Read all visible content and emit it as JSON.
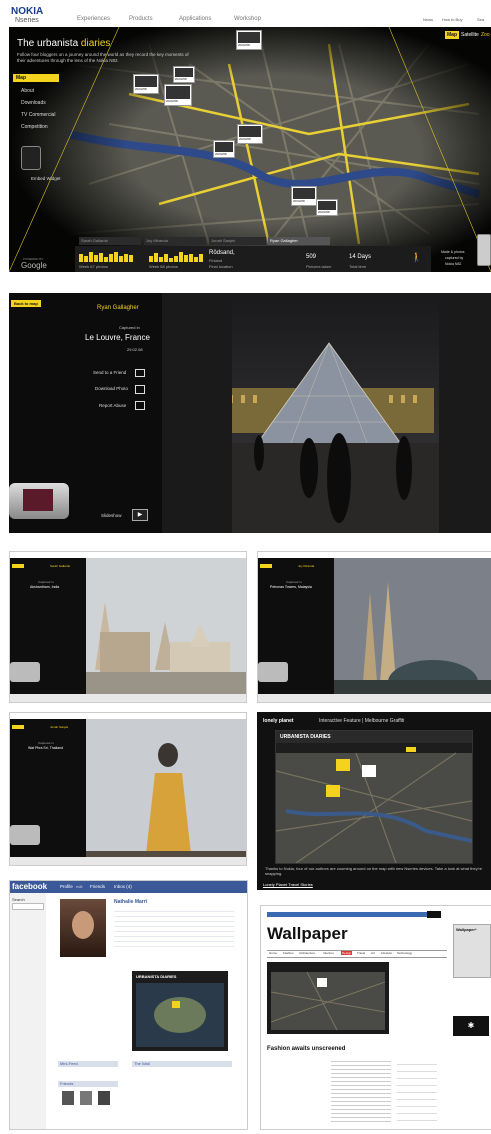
{
  "p1": {
    "logo_top": "NOKIA",
    "logo_sub": "Nseries",
    "nav": [
      "Experiences",
      "Products",
      "Applications",
      "Workshop"
    ],
    "top_links": [
      "News",
      "How to Buy",
      "Sea"
    ],
    "map_modes": [
      "Map",
      "Satellite",
      "Zoo"
    ],
    "title_plain": "The urbanista",
    "title_accent": " diaries",
    "intro": "Follow four bloggers on a journey around the world as they record the key moments of their adventures through the lens of the Nokia N82.",
    "menu": [
      "Map",
      "About",
      "Downloads",
      "TV Commercial",
      "Competition"
    ],
    "embed": "Embed Widget",
    "powered": "POWERED BY",
    "google": "Google",
    "tabs": [
      "Sarah Gallardo",
      "Joy Miranda",
      "Jonah Sanjek",
      "Ryan Gallagher"
    ],
    "stats": {
      "week1": "Week 67 photos",
      "week2": "Week 68 photos",
      "location": "Rödsand,",
      "country": "Finland",
      "final_location": "Final location",
      "pictures_val": "509",
      "pictures_lbl": "Pictures taken",
      "days_val": "14 Days",
      "days_lbl": "Total time"
    },
    "captured": [
      "Made & photos",
      "captured by",
      "Nokia N82"
    ],
    "markers": [
      "20/02/08",
      "20/02/08",
      "20/02/08",
      "20/02/08",
      "20/02/08",
      "20/02/08",
      "20/02/08",
      "20/02/08"
    ]
  },
  "p2": {
    "back": "Back to map",
    "name": "Ryan Gallagher",
    "captured_in": "Captured in",
    "place": "Le Louvre, France",
    "date": "29.02.08",
    "actions": [
      "Send to a Friend",
      "Download Photo",
      "Report Abuse"
    ],
    "slideshow": "Slideshow"
  },
  "mini": [
    {
      "caption": "Captured in",
      "place": "Akshardham, India",
      "who": "Sarah Gallardo"
    },
    {
      "caption": "Captured in",
      "place": "Petronas Towers, Malaysia",
      "who": "Joy Miranda"
    },
    {
      "caption": "Captured in",
      "place": "Wat Phra Sri, Thailand",
      "who": "Jonah Sanjek"
    }
  ],
  "lp": {
    "brand": "lonely planet",
    "feature": "Interactive Feature | Melbourne Graffiti",
    "widget_title": "URBANISTA DIARIES",
    "caption": "Thanks to Nokia, four of our authors are zooming around on the map with new Nseries devices. Take a look at what they're snapping.",
    "link": "Lonely Planet Travel Stories"
  },
  "fb": {
    "logo": "facebook",
    "nav": [
      "Profile",
      "edit",
      "Friends",
      "Inbox (4)"
    ],
    "name": "Nathalie Marri",
    "search": "Search",
    "widget": "URBANISTA DIARIES",
    "sections": [
      "Mini-Feed",
      "Friends",
      "The Wall"
    ]
  },
  "wp": {
    "logo": "Wallpaper",
    "headline": "Fashion awaits unscreened",
    "nav": [
      "Home",
      "Fashion",
      "Architecture",
      "Interiors",
      "Design",
      "Travel",
      "Art",
      "Lifestyle",
      "Technology"
    ],
    "ad": "Wallpaper*"
  },
  "colors": {
    "accent": "#f3d31e",
    "fb": "#3b5998",
    "dark": "#111111"
  }
}
